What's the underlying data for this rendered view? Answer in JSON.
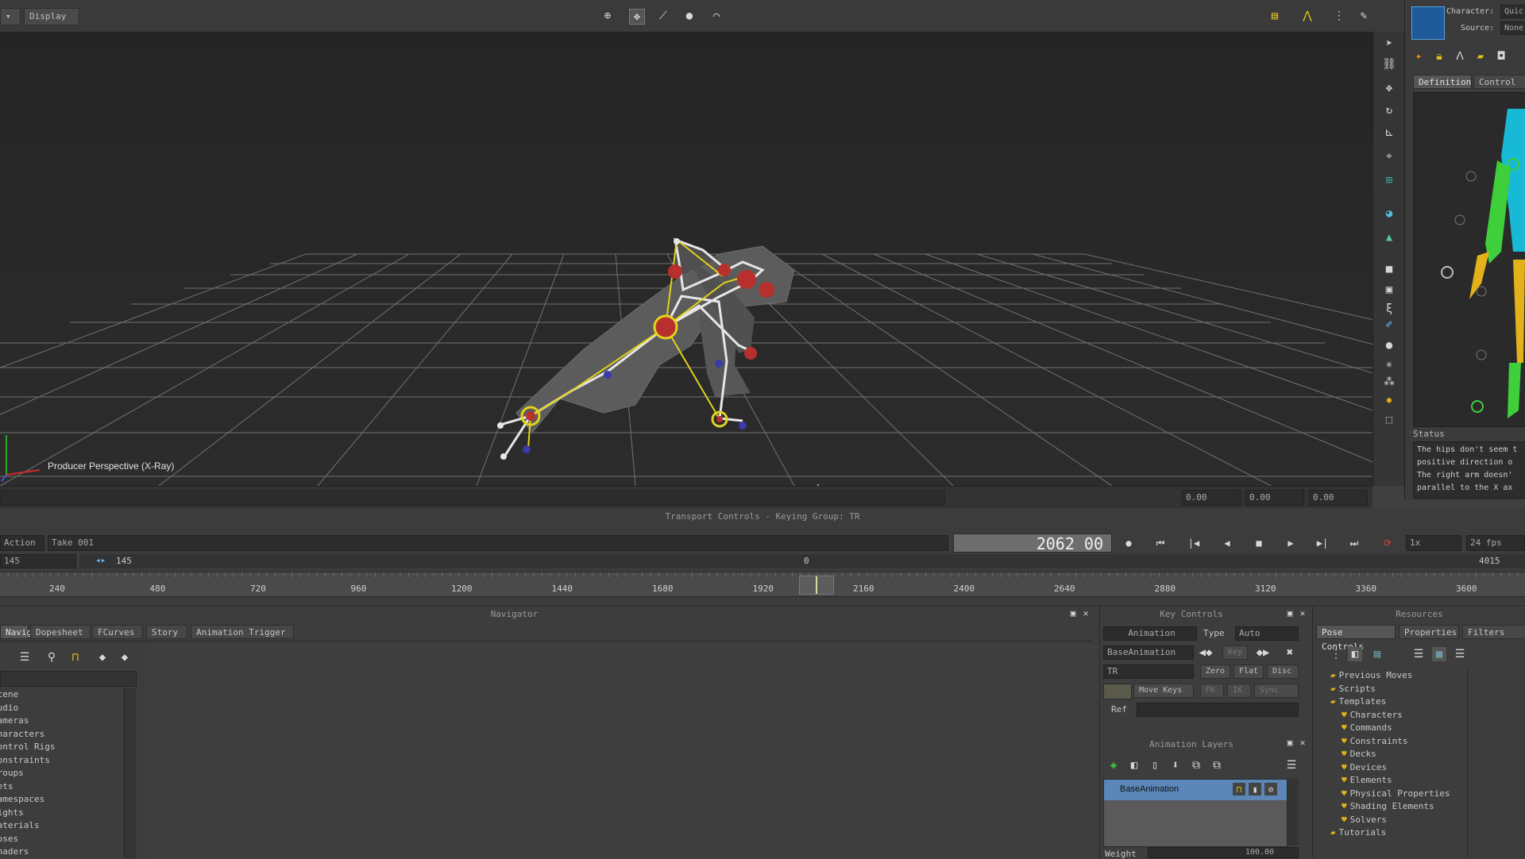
{
  "toolbar": {
    "left_btn": "▾",
    "display_menu": "Display"
  },
  "viewport": {
    "camera_label": "Producer Perspective (X-Ray)",
    "readout_x": "0.00",
    "readout_y": "0.00",
    "readout_z": "0.00"
  },
  "character_panel": {
    "character_label": "Character:",
    "character_value": "Quic",
    "source_label": "Source:",
    "source_value": "None",
    "tabs": [
      "Definition",
      "Control"
    ],
    "status_title": "Status",
    "status_text": "The hips don't seem t positive direction o The right arm doesn' parallel to the X ax"
  },
  "transport": {
    "title": "Transport Controls  -  Keying Group: TR",
    "action_label": "Action",
    "take_value": "Take 001",
    "timecode": "2062 00",
    "speed_value": "1x",
    "fps_value": "24 fps",
    "range_start": "145",
    "range_start2": "145",
    "marker_zero": "0",
    "range_end": "4015",
    "ruler": [
      "240",
      "480",
      "720",
      "960",
      "1200",
      "1440",
      "1680",
      "1920",
      "2160",
      "2400",
      "2640",
      "2880",
      "3120",
      "3360",
      "3600"
    ]
  },
  "navigator": {
    "title": "Navigator",
    "tabs": [
      "Navigator",
      "Dopesheet",
      "FCurves",
      "Story",
      "Animation Trigger"
    ],
    "tree": [
      "Scene",
      "Audio",
      "Cameras",
      "Characters",
      "Control Rigs",
      "Constraints",
      "Groups",
      "Sets",
      "Namespaces",
      "Lights",
      "Materials",
      "Poses",
      "Shaders"
    ]
  },
  "key_controls": {
    "title": "Key Controls",
    "mode": "Animation",
    "type_label": "Type",
    "type_value": "Auto",
    "layer_value": "BaseAnimation",
    "key_label": "Key",
    "group_value": "TR",
    "zero": "Zero",
    "flat": "Flat",
    "disc": "Disc",
    "move_keys": "Move Keys",
    "fk": "FK",
    "ik": "IK",
    "sync": "Sync",
    "ref_label": "Ref",
    "layers_title": "Animation Layers",
    "base_layer": "BaseAnimation",
    "weight_label": "Weight",
    "weight_value": "100.00"
  },
  "resources": {
    "title": "Resources",
    "tabs": [
      "Pose Controls",
      "Properties",
      "Filters"
    ],
    "tree": [
      "Previous Moves",
      "Scripts",
      "Templates",
      "Characters",
      "Commands",
      "Constraints",
      "Decks",
      "Devices",
      "Elements",
      "Physical Properties",
      "Shading Elements",
      "Solvers",
      "Tutorials"
    ]
  },
  "colors": {
    "accent_yellow": "#e3d21a",
    "bone_white": "#e6e6e6",
    "joint_red": "#b8302e",
    "green_body": "#3fcf3a",
    "cyan_body": "#17b9d6"
  }
}
